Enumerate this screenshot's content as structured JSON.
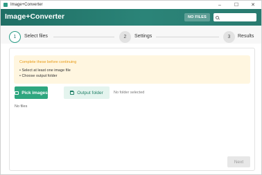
{
  "window": {
    "title": "Image+Converter",
    "controls": {
      "minimize": "–",
      "maximize": "☐",
      "close": "✕"
    }
  },
  "header": {
    "title": "Image+Converter",
    "badge": "NO FILES",
    "search": {
      "value": "",
      "placeholder": ""
    }
  },
  "stepper": {
    "steps": [
      {
        "number": "1",
        "label": "Select files",
        "state": "active"
      },
      {
        "number": "2",
        "label": "Settings",
        "state": "inactive"
      },
      {
        "number": "3",
        "label": "Results",
        "state": "inactive"
      }
    ]
  },
  "notice": {
    "title": "Complete these before continuing",
    "items": [
      "• Select at least one image file",
      "• Choose output folder"
    ]
  },
  "actions": {
    "pick_images": "Pick images",
    "output_folder": "Output folder",
    "folder_status": "No folder selected"
  },
  "files": {
    "empty_text": "No files"
  },
  "footer": {
    "next": "Next"
  },
  "colors": {
    "accent": "#2ea67f",
    "header": "#2a7b70",
    "warning": "#e79a14"
  }
}
